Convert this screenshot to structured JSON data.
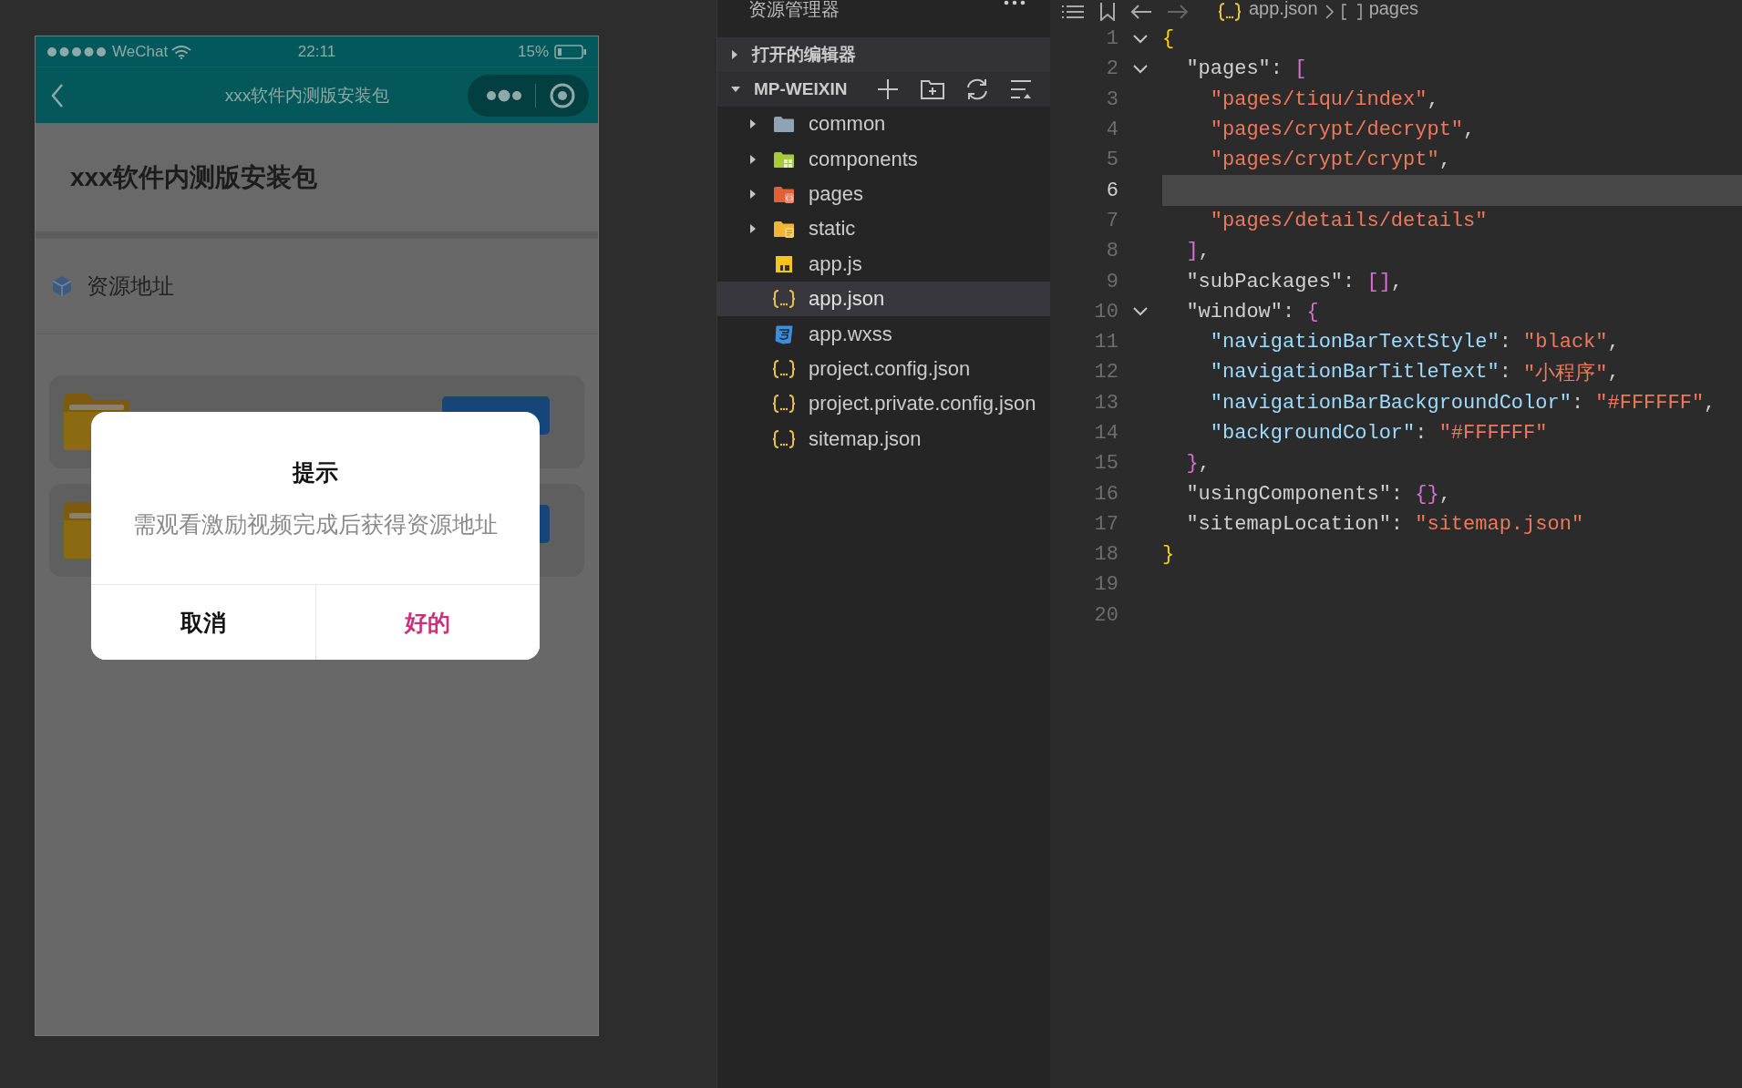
{
  "simulator": {
    "status_bar": {
      "carrier": "WeChat",
      "time": "22:11",
      "battery": "15%"
    },
    "nav_bar": {
      "title": "xxx软件内测版安装包"
    },
    "page": {
      "heading": "xxx软件内测版安装包",
      "section_label": "资源地址",
      "cards": [
        {
          "kind": "folder"
        },
        {
          "kind": "folder"
        }
      ]
    },
    "dialog": {
      "title": "提示",
      "message": "需观看激励视频完成后获得资源地址",
      "buttons": [
        {
          "label": "取消",
          "kind": "cancel"
        },
        {
          "label": "好的",
          "kind": "confirm"
        }
      ]
    }
  },
  "explorer": {
    "title": "资源管理器",
    "sections": [
      {
        "label": "打开的编辑器",
        "expanded": false
      },
      {
        "label": "MP-WEIXIN",
        "expanded": true
      }
    ],
    "items": [
      {
        "name": "common",
        "kind": "folder",
        "expanded": false,
        "selected": false
      },
      {
        "name": "components",
        "kind": "components-folder",
        "expanded": false,
        "selected": false
      },
      {
        "name": "pages",
        "kind": "pages-folder",
        "expanded": false,
        "selected": false
      },
      {
        "name": "static",
        "kind": "static-folder",
        "expanded": false,
        "selected": false
      },
      {
        "name": "app.js",
        "kind": "js",
        "selected": false
      },
      {
        "name": "app.json",
        "kind": "json",
        "selected": true
      },
      {
        "name": "app.wxss",
        "kind": "css",
        "selected": false
      },
      {
        "name": "project.config.json",
        "kind": "json",
        "selected": false
      },
      {
        "name": "project.private.config.json",
        "kind": "json",
        "selected": false
      },
      {
        "name": "sitemap.json",
        "kind": "json",
        "selected": false
      }
    ]
  },
  "editor": {
    "breadcrumb": [
      "app.json",
      "pages"
    ],
    "lines": [
      {
        "number": "1",
        "foldable": true,
        "current": false,
        "tokens": [
          {
            "kind": "bracket1",
            "text": "{"
          }
        ]
      },
      {
        "number": "2",
        "foldable": true,
        "current": false,
        "tokens": [
          {
            "kind": "key",
            "text": "  \"pages\""
          },
          {
            "kind": "punct",
            "text": ": "
          },
          {
            "kind": "bracket2",
            "text": "["
          }
        ]
      },
      {
        "number": "3",
        "foldable": false,
        "current": false,
        "tokens": [
          {
            "kind": "string",
            "text": "    \"pages/tiqu/index\""
          },
          {
            "kind": "punct",
            "text": ","
          }
        ]
      },
      {
        "number": "4",
        "foldable": false,
        "current": false,
        "tokens": [
          {
            "kind": "string",
            "text": "    \"pages/crypt/decrypt\""
          },
          {
            "kind": "punct",
            "text": ","
          }
        ]
      },
      {
        "number": "5",
        "foldable": false,
        "current": false,
        "tokens": [
          {
            "kind": "string",
            "text": "    \"pages/crypt/crypt\""
          },
          {
            "kind": "punct",
            "text": ","
          }
        ]
      },
      {
        "number": "6",
        "foldable": false,
        "current": true
      },
      {
        "number": "7",
        "foldable": false,
        "current": false,
        "tokens": [
          {
            "kind": "string",
            "text": "    \"pages/details/details\""
          }
        ]
      },
      {
        "number": "8",
        "foldable": false,
        "current": false,
        "tokens": [
          {
            "kind": "bracket2",
            "text": "  ]"
          },
          {
            "kind": "punct",
            "text": ","
          }
        ]
      },
      {
        "number": "9",
        "foldable": false,
        "current": false,
        "tokens": [
          {
            "kind": "key",
            "text": "  \"subPackages\""
          },
          {
            "kind": "punct",
            "text": ": "
          },
          {
            "kind": "bracket2",
            "text": "[]"
          },
          {
            "kind": "punct",
            "text": ","
          }
        ]
      },
      {
        "number": "10",
        "foldable": true,
        "current": false,
        "tokens": [
          {
            "kind": "key",
            "text": "  \"window\""
          },
          {
            "kind": "punct",
            "text": ": "
          },
          {
            "kind": "bracket2",
            "text": "{"
          }
        ]
      },
      {
        "number": "11",
        "foldable": false,
        "current": false,
        "tokens": [
          {
            "kind": "prop",
            "text": "    \"navigationBarTextStyle\""
          },
          {
            "kind": "punct",
            "text": ": "
          },
          {
            "kind": "string",
            "text": "\"black\""
          },
          {
            "kind": "punct",
            "text": ","
          }
        ]
      },
      {
        "number": "12",
        "foldable": false,
        "current": false,
        "tokens": [
          {
            "kind": "prop",
            "text": "    \"navigationBarTitleText\""
          },
          {
            "kind": "punct",
            "text": ": "
          },
          {
            "kind": "string",
            "text": "\"小程序\""
          },
          {
            "kind": "punct",
            "text": ","
          }
        ]
      },
      {
        "number": "13",
        "foldable": false,
        "current": false,
        "tokens": [
          {
            "kind": "prop",
            "text": "    \"navigationBarBackgroundColor\""
          },
          {
            "kind": "punct",
            "text": ": "
          },
          {
            "kind": "string",
            "text": "\"#FFFFFF\""
          },
          {
            "kind": "punct",
            "text": ","
          }
        ]
      },
      {
        "number": "14",
        "foldable": false,
        "current": false,
        "tokens": [
          {
            "kind": "prop",
            "text": "    \"backgroundColor\""
          },
          {
            "kind": "punct",
            "text": ": "
          },
          {
            "kind": "string",
            "text": "\"#FFFFFF\""
          }
        ]
      },
      {
        "number": "15",
        "foldable": false,
        "current": false,
        "tokens": [
          {
            "kind": "bracket2",
            "text": "  }"
          },
          {
            "kind": "punct",
            "text": ","
          }
        ]
      },
      {
        "number": "16",
        "foldable": false,
        "current": false,
        "tokens": [
          {
            "kind": "key",
            "text": "  \"usingComponents\""
          },
          {
            "kind": "punct",
            "text": ": "
          },
          {
            "kind": "bracket2",
            "text": "{}"
          },
          {
            "kind": "punct",
            "text": ","
          }
        ]
      },
      {
        "number": "17",
        "foldable": false,
        "current": false,
        "tokens": [
          {
            "kind": "key",
            "text": "  \"sitemapLocation\""
          },
          {
            "kind": "punct",
            "text": ": "
          },
          {
            "kind": "string",
            "text": "\"sitemap.json\""
          }
        ]
      },
      {
        "number": "18",
        "foldable": false,
        "current": false,
        "tokens": [
          {
            "kind": "bracket1",
            "text": "}"
          }
        ]
      },
      {
        "number": "19",
        "foldable": false,
        "current": false
      },
      {
        "number": "20",
        "foldable": false,
        "current": false
      }
    ]
  }
}
